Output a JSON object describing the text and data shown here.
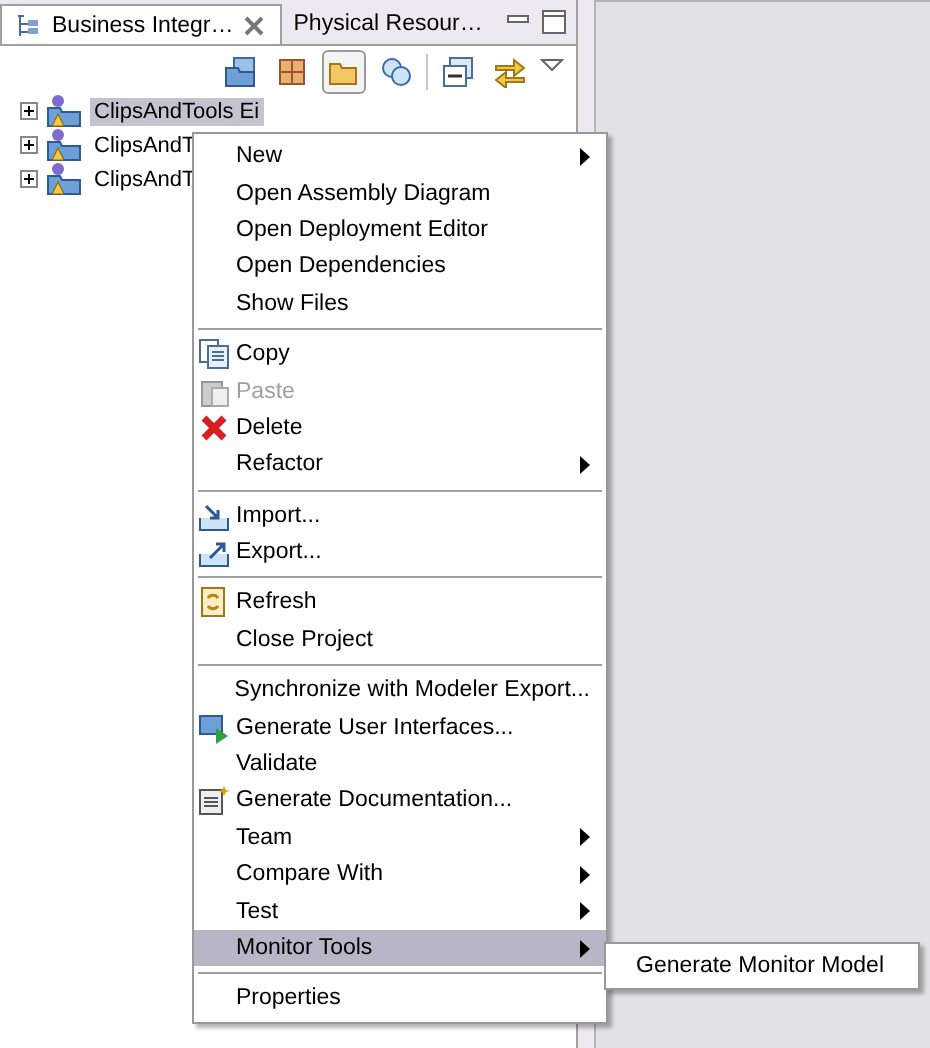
{
  "tabs": [
    {
      "label": "Business Integr…",
      "selected": true,
      "closable": true
    },
    {
      "label": "Physical Resour…",
      "selected": false,
      "closable": false
    }
  ],
  "toolbar": [
    {
      "pressed": false
    },
    {
      "pressed": false
    },
    {
      "pressed": true
    },
    {
      "pressed": false
    },
    {
      "pressed": false
    },
    {
      "pressed": false
    }
  ],
  "tree": [
    {
      "label": "ClipsAndTools Ei",
      "selected": true
    },
    {
      "label": "ClipsAndT",
      "selected": false
    },
    {
      "label": "ClipsAndT",
      "selected": false
    }
  ],
  "menu": [
    [
      {
        "label": "New",
        "submenu": true,
        "disabled": false,
        "selected": false
      },
      {
        "label": "Open Assembly Diagram",
        "submenu": false,
        "disabled": false,
        "selected": false
      },
      {
        "label": "Open Deployment Editor",
        "submenu": false,
        "disabled": false,
        "selected": false
      },
      {
        "label": "Open Dependencies",
        "submenu": false,
        "disabled": false,
        "selected": false
      },
      {
        "label": "Show Files",
        "submenu": false,
        "disabled": false,
        "selected": false
      }
    ],
    [
      {
        "label": "Copy",
        "submenu": false,
        "disabled": false,
        "selected": false
      },
      {
        "label": "Paste",
        "submenu": false,
        "disabled": true,
        "selected": false
      },
      {
        "label": "Delete",
        "submenu": false,
        "disabled": false,
        "selected": false
      },
      {
        "label": "Refactor",
        "submenu": true,
        "disabled": false,
        "selected": false
      }
    ],
    [
      {
        "label": "Import...",
        "submenu": false,
        "disabled": false,
        "selected": false
      },
      {
        "label": "Export...",
        "submenu": false,
        "disabled": false,
        "selected": false
      }
    ],
    [
      {
        "label": "Refresh",
        "submenu": false,
        "disabled": false,
        "selected": false
      },
      {
        "label": "Close Project",
        "submenu": false,
        "disabled": false,
        "selected": false
      }
    ],
    [
      {
        "label": "Synchronize with Modeler Export...",
        "submenu": false,
        "disabled": false,
        "selected": false
      },
      {
        "label": "Generate User Interfaces...",
        "submenu": false,
        "disabled": false,
        "selected": false
      },
      {
        "label": "Validate",
        "submenu": false,
        "disabled": false,
        "selected": false
      },
      {
        "label": "Generate Documentation...",
        "submenu": false,
        "disabled": false,
        "selected": false
      },
      {
        "label": "Team",
        "submenu": true,
        "disabled": false,
        "selected": false
      },
      {
        "label": "Compare With",
        "submenu": true,
        "disabled": false,
        "selected": false
      },
      {
        "label": "Test",
        "submenu": true,
        "disabled": false,
        "selected": false
      },
      {
        "label": "Monitor Tools",
        "submenu": true,
        "disabled": false,
        "selected": true
      }
    ],
    [
      {
        "label": "Properties",
        "submenu": false,
        "disabled": false,
        "selected": false
      }
    ]
  ],
  "submenu": [
    {
      "label": "Generate Monitor Model",
      "selected": false
    }
  ]
}
